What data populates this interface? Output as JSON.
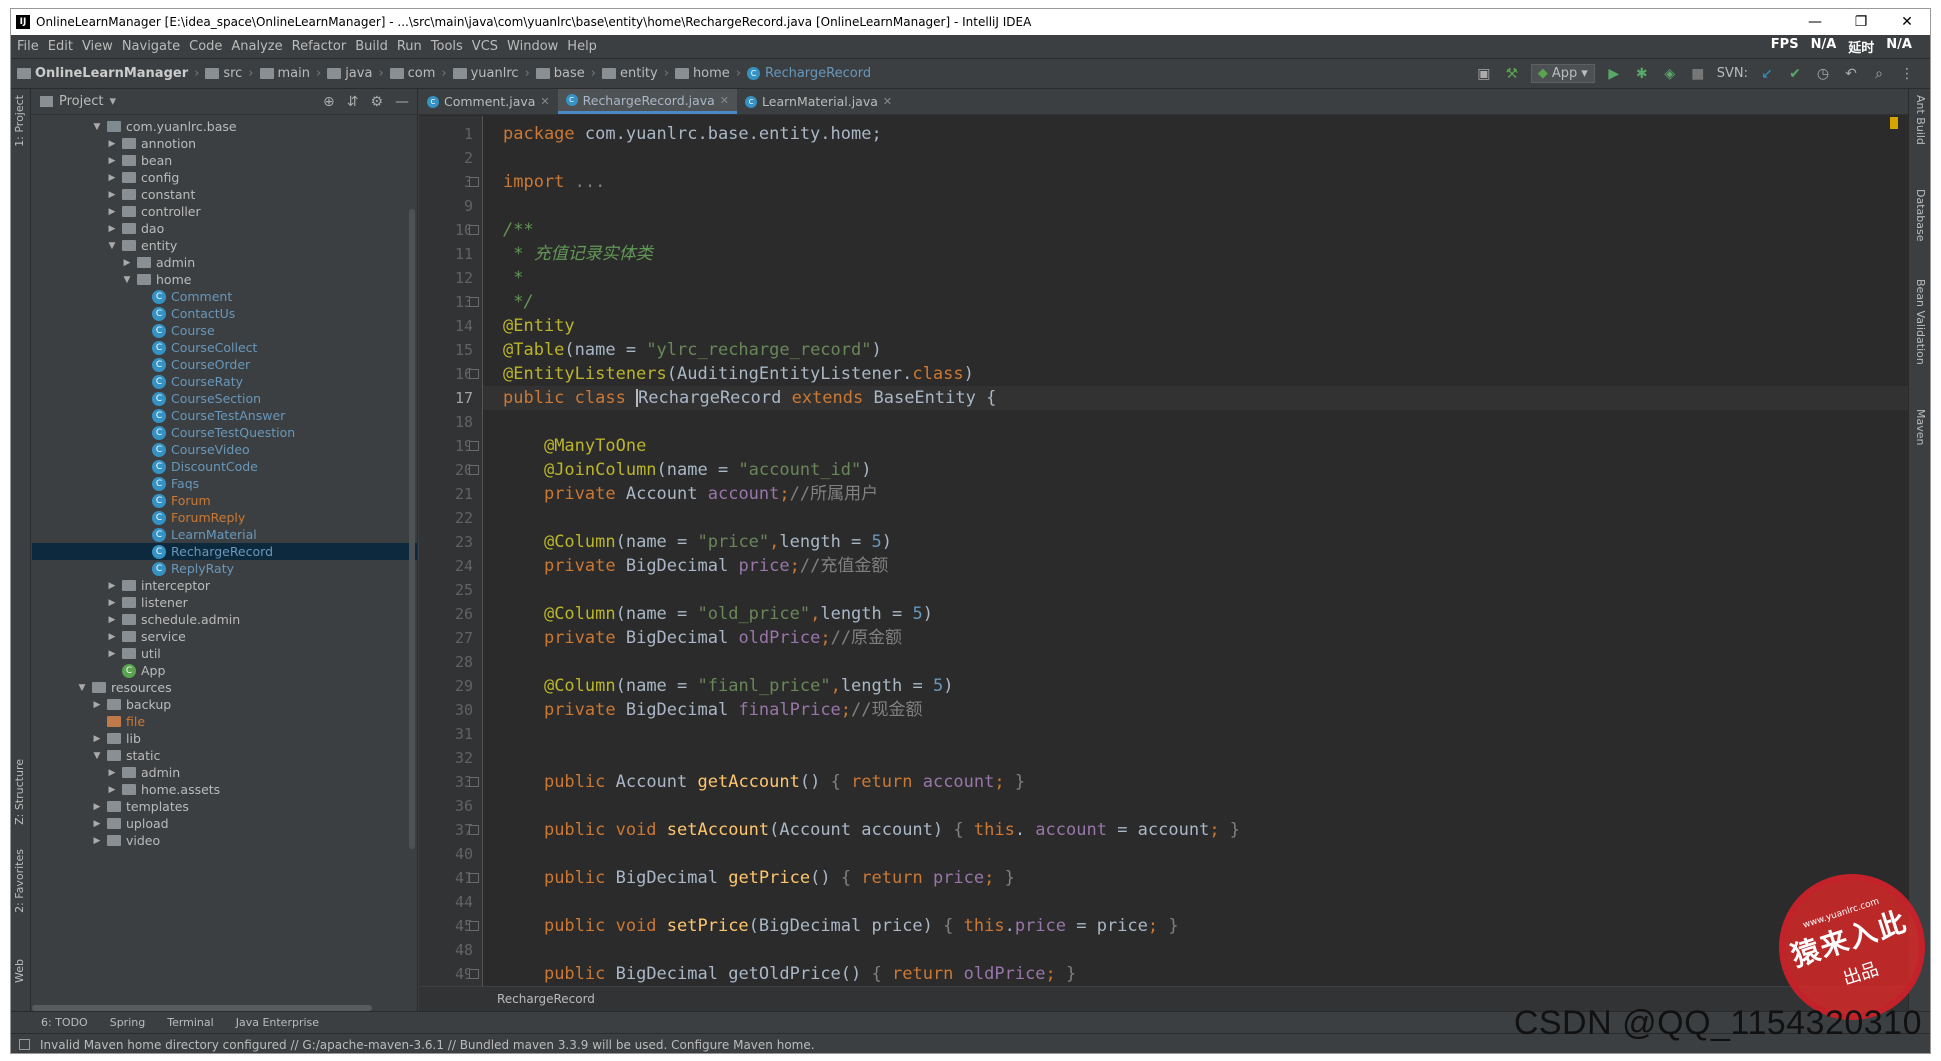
{
  "titlebar": {
    "title": "OnlineLearnManager [E:\\idea_space\\OnlineLearnManager] - ...\\src\\main\\java\\com\\yuanlrc\\base\\entity\\home\\RechargeRecord.java [OnlineLearnManager] - IntelliJ IDEA",
    "app_icon": "IJ"
  },
  "menu": [
    "File",
    "Edit",
    "View",
    "Navigate",
    "Code",
    "Analyze",
    "Refactor",
    "Build",
    "Run",
    "Tools",
    "VCS",
    "Window",
    "Help"
  ],
  "fps": {
    "fps_label": "FPS",
    "fps_value": "N/A",
    "delay_label": "延时",
    "delay_value": "N/A"
  },
  "breadcrumbs": [
    "OnlineLearnManager",
    "src",
    "main",
    "java",
    "com",
    "yuanlrc",
    "base",
    "entity",
    "home",
    "RechargeRecord"
  ],
  "toolbar": {
    "run_config": "App",
    "svn_label": "SVN:"
  },
  "project": {
    "title": "Project",
    "tree": [
      {
        "label": "com.yuanlrc.base",
        "depth": 0,
        "kind": "pkg",
        "arrow": "▼"
      },
      {
        "label": "annotion",
        "depth": 1,
        "kind": "folder",
        "arrow": "▶"
      },
      {
        "label": "bean",
        "depth": 1,
        "kind": "folder",
        "arrow": "▶"
      },
      {
        "label": "config",
        "depth": 1,
        "kind": "folder",
        "arrow": "▶"
      },
      {
        "label": "constant",
        "depth": 1,
        "kind": "folder",
        "arrow": "▶"
      },
      {
        "label": "controller",
        "depth": 1,
        "kind": "folder",
        "arrow": "▶"
      },
      {
        "label": "dao",
        "depth": 1,
        "kind": "folder",
        "arrow": "▶"
      },
      {
        "label": "entity",
        "depth": 1,
        "kind": "folder",
        "arrow": "▼"
      },
      {
        "label": "admin",
        "depth": 2,
        "kind": "folder",
        "arrow": "▶"
      },
      {
        "label": "home",
        "depth": 2,
        "kind": "folder",
        "arrow": "▼"
      },
      {
        "label": "Comment",
        "depth": 3,
        "kind": "class",
        "color": "blue"
      },
      {
        "label": "ContactUs",
        "depth": 3,
        "kind": "class",
        "color": "blue"
      },
      {
        "label": "Course",
        "depth": 3,
        "kind": "class",
        "color": "blue"
      },
      {
        "label": "CourseCollect",
        "depth": 3,
        "kind": "class",
        "color": "blue"
      },
      {
        "label": "CourseOrder",
        "depth": 3,
        "kind": "class",
        "color": "blue"
      },
      {
        "label": "CourseRaty",
        "depth": 3,
        "kind": "class",
        "color": "blue"
      },
      {
        "label": "CourseSection",
        "depth": 3,
        "kind": "class",
        "color": "blue"
      },
      {
        "label": "CourseTestAnswer",
        "depth": 3,
        "kind": "class",
        "color": "blue"
      },
      {
        "label": "CourseTestQuestion",
        "depth": 3,
        "kind": "class",
        "color": "blue"
      },
      {
        "label": "CourseVideo",
        "depth": 3,
        "kind": "class",
        "color": "blue"
      },
      {
        "label": "DiscountCode",
        "depth": 3,
        "kind": "class",
        "color": "blue"
      },
      {
        "label": "Faqs",
        "depth": 3,
        "kind": "class",
        "color": "blue"
      },
      {
        "label": "Forum",
        "depth": 3,
        "kind": "class",
        "color": "red"
      },
      {
        "label": "ForumReply",
        "depth": 3,
        "kind": "class",
        "color": "red"
      },
      {
        "label": "LearnMaterial",
        "depth": 3,
        "kind": "class",
        "color": "blue"
      },
      {
        "label": "RechargeRecord",
        "depth": 3,
        "kind": "class",
        "color": "blue",
        "selected": true
      },
      {
        "label": "ReplyRaty",
        "depth": 3,
        "kind": "class",
        "color": "blue"
      },
      {
        "label": "interceptor",
        "depth": 1,
        "kind": "folder",
        "arrow": "▶"
      },
      {
        "label": "listener",
        "depth": 1,
        "kind": "folder",
        "arrow": "▶"
      },
      {
        "label": "schedule.admin",
        "depth": 1,
        "kind": "folder",
        "arrow": "▶"
      },
      {
        "label": "service",
        "depth": 1,
        "kind": "folder",
        "arrow": "▶"
      },
      {
        "label": "util",
        "depth": 1,
        "kind": "folder",
        "arrow": "▶"
      },
      {
        "label": "App",
        "depth": 1,
        "kind": "class",
        "color": "app"
      },
      {
        "label": "resources",
        "depth": -1,
        "kind": "folder",
        "arrow": "▼"
      },
      {
        "label": "backup",
        "depth": 0,
        "kind": "folder",
        "arrow": "▶"
      },
      {
        "label": "file",
        "depth": 0,
        "kind": "folder",
        "color": "red"
      },
      {
        "label": "lib",
        "depth": 0,
        "kind": "folder",
        "arrow": "▶"
      },
      {
        "label": "static",
        "depth": 0,
        "kind": "folder",
        "arrow": "▼"
      },
      {
        "label": "admin",
        "depth": 1,
        "kind": "folder",
        "arrow": "▶"
      },
      {
        "label": "home.assets",
        "depth": 1,
        "kind": "folder",
        "arrow": "▶"
      },
      {
        "label": "templates",
        "depth": 0,
        "kind": "folder",
        "arrow": "▶"
      },
      {
        "label": "upload",
        "depth": 0,
        "kind": "folder",
        "arrow": "▶"
      },
      {
        "label": "video",
        "depth": 0,
        "kind": "folder",
        "arrow": "▶"
      }
    ]
  },
  "tabs": [
    {
      "label": "Comment.java",
      "active": false
    },
    {
      "label": "RechargeRecord.java",
      "active": true
    },
    {
      "label": "LearnMaterial.java",
      "active": false
    }
  ],
  "code": {
    "current_line": "17",
    "lines": [
      {
        "n": "1",
        "t": [
          [
            "k",
            "package "
          ],
          [
            "",
            "com.yuanlrc.base.entity.home;"
          ]
        ]
      },
      {
        "n": "2",
        "t": []
      },
      {
        "n": "3",
        "fold": true,
        "t": [
          [
            "k",
            "import "
          ],
          [
            "g",
            "..."
          ]
        ]
      },
      {
        "n": "9",
        "t": []
      },
      {
        "n": "10",
        "fold": true,
        "t": [
          [
            "c",
            "/**"
          ]
        ]
      },
      {
        "n": "11",
        "t": [
          [
            "c",
            " * 充值记录实体类"
          ]
        ]
      },
      {
        "n": "12",
        "t": [
          [
            "c",
            " *"
          ]
        ]
      },
      {
        "n": "13",
        "fold": true,
        "t": [
          [
            "c",
            " */"
          ]
        ]
      },
      {
        "n": "14",
        "t": [
          [
            "an",
            "@Entity"
          ]
        ]
      },
      {
        "n": "15",
        "t": [
          [
            "an",
            "@Table"
          ],
          [
            "",
            "(name = "
          ],
          [
            "s",
            "\"ylrc_recharge_record\""
          ],
          [
            "",
            ")"
          ]
        ]
      },
      {
        "n": "16",
        "fold": true,
        "t": [
          [
            "an",
            "@EntityListeners"
          ],
          [
            "",
            "(AuditingEntityListener."
          ],
          [
            "k",
            "class"
          ],
          [
            "",
            ")"
          ]
        ]
      },
      {
        "n": "17",
        "t": [
          [
            "k",
            "public class "
          ],
          [
            "cursor",
            ""
          ],
          [
            "",
            "RechargeRecord "
          ],
          [
            "k",
            "extends "
          ],
          [
            "",
            "BaseEntity {"
          ]
        ]
      },
      {
        "n": "18",
        "t": []
      },
      {
        "n": "19",
        "fold": true,
        "t": [
          [
            "",
            "    "
          ],
          [
            "an",
            "@ManyToOne"
          ]
        ]
      },
      {
        "n": "20",
        "fold": true,
        "t": [
          [
            "",
            "    "
          ],
          [
            "an",
            "@JoinColumn"
          ],
          [
            "",
            "(name = "
          ],
          [
            "s",
            "\"account_id\""
          ],
          [
            "",
            ")"
          ]
        ]
      },
      {
        "n": "21",
        "t": [
          [
            "",
            "    "
          ],
          [
            "k",
            "private "
          ],
          [
            "",
            "Account "
          ],
          [
            "f",
            "account"
          ],
          [
            "k",
            ";"
          ],
          [
            "cg",
            "//所属用户"
          ]
        ]
      },
      {
        "n": "22",
        "t": []
      },
      {
        "n": "23",
        "t": [
          [
            "",
            "    "
          ],
          [
            "an",
            "@Column"
          ],
          [
            "",
            "(name = "
          ],
          [
            "s",
            "\"price\""
          ],
          [
            "k",
            ","
          ],
          [
            "",
            "length = "
          ],
          [
            "n",
            "5"
          ],
          [
            "",
            ")"
          ]
        ]
      },
      {
        "n": "24",
        "t": [
          [
            "",
            "    "
          ],
          [
            "k",
            "private "
          ],
          [
            "",
            "BigDecimal "
          ],
          [
            "f",
            "price"
          ],
          [
            "k",
            ";"
          ],
          [
            "cg",
            "//充值金额"
          ]
        ]
      },
      {
        "n": "25",
        "t": []
      },
      {
        "n": "26",
        "t": [
          [
            "",
            "    "
          ],
          [
            "an",
            "@Column"
          ],
          [
            "",
            "(name = "
          ],
          [
            "s",
            "\"old_price\""
          ],
          [
            "k",
            ","
          ],
          [
            "",
            "length = "
          ],
          [
            "n",
            "5"
          ],
          [
            "",
            ")"
          ]
        ]
      },
      {
        "n": "27",
        "t": [
          [
            "",
            "    "
          ],
          [
            "k",
            "private "
          ],
          [
            "",
            "BigDecimal "
          ],
          [
            "f",
            "oldPrice"
          ],
          [
            "k",
            ";"
          ],
          [
            "cg",
            "//原金额"
          ]
        ]
      },
      {
        "n": "28",
        "t": []
      },
      {
        "n": "29",
        "t": [
          [
            "",
            "    "
          ],
          [
            "an",
            "@Column"
          ],
          [
            "",
            "(name = "
          ],
          [
            "s",
            "\"fianl_price\""
          ],
          [
            "k",
            ","
          ],
          [
            "",
            "length = "
          ],
          [
            "n",
            "5"
          ],
          [
            "",
            ")"
          ]
        ]
      },
      {
        "n": "30",
        "t": [
          [
            "",
            "    "
          ],
          [
            "k",
            "private "
          ],
          [
            "",
            "BigDecimal "
          ],
          [
            "f",
            "finalPrice"
          ],
          [
            "k",
            ";"
          ],
          [
            "cg",
            "//现金额"
          ]
        ]
      },
      {
        "n": "31",
        "t": []
      },
      {
        "n": "32",
        "t": []
      },
      {
        "n": "33",
        "fold": true,
        "t": [
          [
            "",
            "    "
          ],
          [
            "k",
            "public "
          ],
          [
            "",
            "Account "
          ],
          [
            "m",
            "getAccount"
          ],
          [
            "",
            "() "
          ],
          [
            "g",
            "{ "
          ],
          [
            "k",
            "return "
          ],
          [
            "f",
            "account"
          ],
          [
            "k",
            ";"
          ],
          [
            "g",
            " }"
          ]
        ]
      },
      {
        "n": "36",
        "t": []
      },
      {
        "n": "37",
        "fold": true,
        "t": [
          [
            "",
            "    "
          ],
          [
            "k",
            "public void "
          ],
          [
            "m",
            "setAccount"
          ],
          [
            "",
            "(Account account) "
          ],
          [
            "g",
            "{ "
          ],
          [
            "k",
            "this"
          ],
          [
            "",
            ". "
          ],
          [
            "f",
            "account"
          ],
          [
            "",
            " = account"
          ],
          [
            "k",
            ";"
          ],
          [
            "g",
            " }"
          ]
        ]
      },
      {
        "n": "40",
        "t": []
      },
      {
        "n": "41",
        "fold": true,
        "t": [
          [
            "",
            "    "
          ],
          [
            "k",
            "public "
          ],
          [
            "",
            "BigDecimal "
          ],
          [
            "m",
            "getPrice"
          ],
          [
            "",
            "() "
          ],
          [
            "g",
            "{ "
          ],
          [
            "k",
            "return "
          ],
          [
            "f",
            "price"
          ],
          [
            "k",
            ";"
          ],
          [
            "g",
            " }"
          ]
        ]
      },
      {
        "n": "44",
        "t": []
      },
      {
        "n": "45",
        "fold": true,
        "t": [
          [
            "",
            "    "
          ],
          [
            "k",
            "public void "
          ],
          [
            "m",
            "setPrice"
          ],
          [
            "",
            "(BigDecimal price) "
          ],
          [
            "g",
            "{ "
          ],
          [
            "k",
            "this"
          ],
          [
            "",
            "."
          ],
          [
            "f",
            "price"
          ],
          [
            "",
            " = price"
          ],
          [
            "k",
            ";"
          ],
          [
            "g",
            " }"
          ]
        ]
      },
      {
        "n": "48",
        "t": []
      },
      {
        "n": "49",
        "fold": true,
        "t": [
          [
            "",
            "    "
          ],
          [
            "k",
            "public "
          ],
          [
            "",
            "BigDecimal "
          ],
          [
            "",
            "getOldPrice"
          ],
          [
            "",
            "() "
          ],
          [
            "g",
            "{ "
          ],
          [
            "k",
            "return "
          ],
          [
            "f",
            "oldPrice"
          ],
          [
            "k",
            ";"
          ],
          [
            "g",
            " }"
          ]
        ]
      }
    ]
  },
  "editor_breadcrumb": "RechargeRecord",
  "left_tools": [
    "1: Project",
    "Z: Structure",
    "2: Favorites",
    "Web"
  ],
  "right_tools": [
    "Ant Build",
    "Database",
    "Bean Validation",
    "Maven"
  ],
  "bottom_tabs": [
    "6: TODO",
    "Spring",
    "Terminal",
    "Java Enterprise"
  ],
  "status": "Invalid Maven home directory configured // G:/apache-maven-3.6.1 // Bundled maven 3.3.9 will be used.  Configure Maven home.",
  "watermark": "CSDN @QQ_1154320310",
  "stamp": {
    "main": "猿来入此",
    "sub": "出品",
    "url": "www.yuanlrc.com"
  }
}
